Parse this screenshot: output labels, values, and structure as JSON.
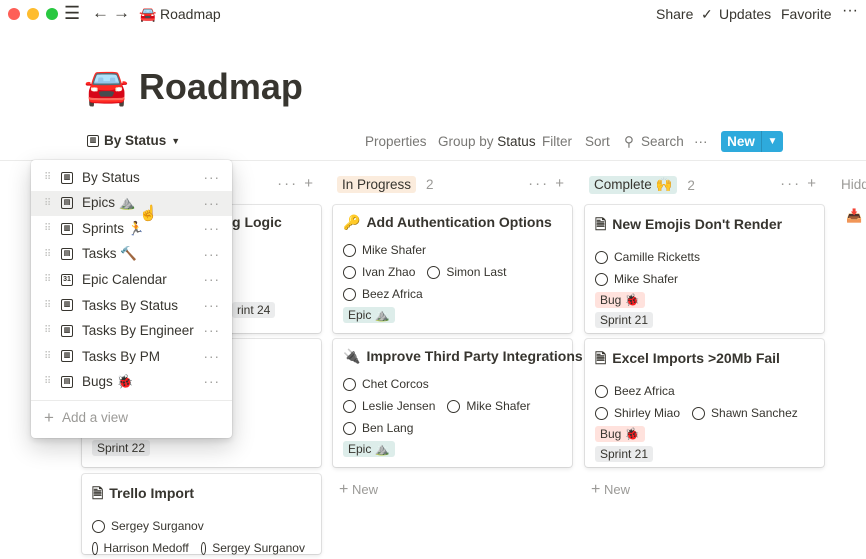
{
  "window": {
    "title": "Roadmap",
    "page_emoji": "🚘",
    "actions": [
      "Share",
      "Updates",
      "Favorite"
    ]
  },
  "page": {
    "title": "Roadmap"
  },
  "toolbar": {
    "view": "By Status",
    "properties": "Properties",
    "group_by": "Group by",
    "group_value": "Status",
    "filter": "Filter",
    "sort": "Sort",
    "search": "Search",
    "more": "···",
    "new": "New"
  },
  "columns": [
    {
      "cards": [
        {
          "title": "g Logic",
          "tags": [
            {
              "label": "rint 24",
              "color": "#ebeced"
            }
          ]
        },
        {
          "title": "",
          "tags": [
            {
              "label": "Sprint 22",
              "color": "#ebeced"
            }
          ]
        },
        {
          "title": "Trello Import",
          "icon": "page-icon",
          "people": [
            [
              "Sergey Surganov"
            ],
            [
              "Harrison Medoff",
              "Sergey Surganov"
            ]
          ],
          "tags": []
        }
      ]
    },
    {
      "label": "In Progress",
      "color": "#fbecdd",
      "count": "2",
      "cards": [
        {
          "title": "Add Authentication Options",
          "icon": "🔑",
          "people": [
            [
              "Mike Shafer"
            ],
            [
              "Ivan Zhao",
              "Simon Last"
            ],
            [
              "Beez Africa"
            ]
          ],
          "tags": [
            {
              "label": "Epic ⛰️",
              "color": "#ddedea"
            }
          ]
        },
        {
          "title": "Improve Third Party Integrations",
          "icon": "🔌",
          "people": [
            [
              "Chet Corcos"
            ],
            [
              "Leslie Jensen",
              "Mike Shafer"
            ],
            [
              "Ben Lang"
            ]
          ],
          "tags": [
            {
              "label": "Epic ⛰️",
              "color": "#ddedea"
            }
          ]
        }
      ],
      "new": "New"
    },
    {
      "label": "Complete 🙌",
      "color": "#ddedea",
      "count": "2",
      "cards": [
        {
          "title": "New Emojis Don't Render",
          "icon": "page-icon",
          "people": [
            [
              "Camille Ricketts"
            ],
            [
              "Mike Shafer"
            ]
          ],
          "tags": [
            {
              "label": "Bug 🐞",
              "color": "#ffe2dd"
            },
            {
              "label": "Sprint 21",
              "color": "#ebeced"
            }
          ]
        },
        {
          "title": "Excel Imports >20Mb Fail",
          "icon": "page-icon",
          "people": [
            [
              "Beez Africa"
            ],
            [
              "Shirley Miao",
              "Shawn Sanchez"
            ]
          ],
          "tags": [
            {
              "label": "Bug 🐞",
              "color": "#ffe2dd"
            },
            {
              "label": "Sprint 21",
              "color": "#ebeced"
            }
          ]
        }
      ],
      "new": "New"
    }
  ],
  "hidden": {
    "label": "Hidden"
  },
  "views_menu": {
    "items": [
      {
        "label": "By Status",
        "type": "board"
      },
      {
        "label": "Epics ⛰️",
        "type": "table",
        "hovered": true
      },
      {
        "label": "Sprints 🏃",
        "type": "board"
      },
      {
        "label": "Tasks 🔨",
        "type": "table"
      },
      {
        "label": "Epic Calendar",
        "type": "calendar"
      },
      {
        "label": "Tasks By Status",
        "type": "board"
      },
      {
        "label": "Tasks By Engineer",
        "type": "board"
      },
      {
        "label": "Tasks By PM",
        "type": "board"
      },
      {
        "label": "Bugs 🐞",
        "type": "table"
      }
    ],
    "add": "Add a view"
  }
}
